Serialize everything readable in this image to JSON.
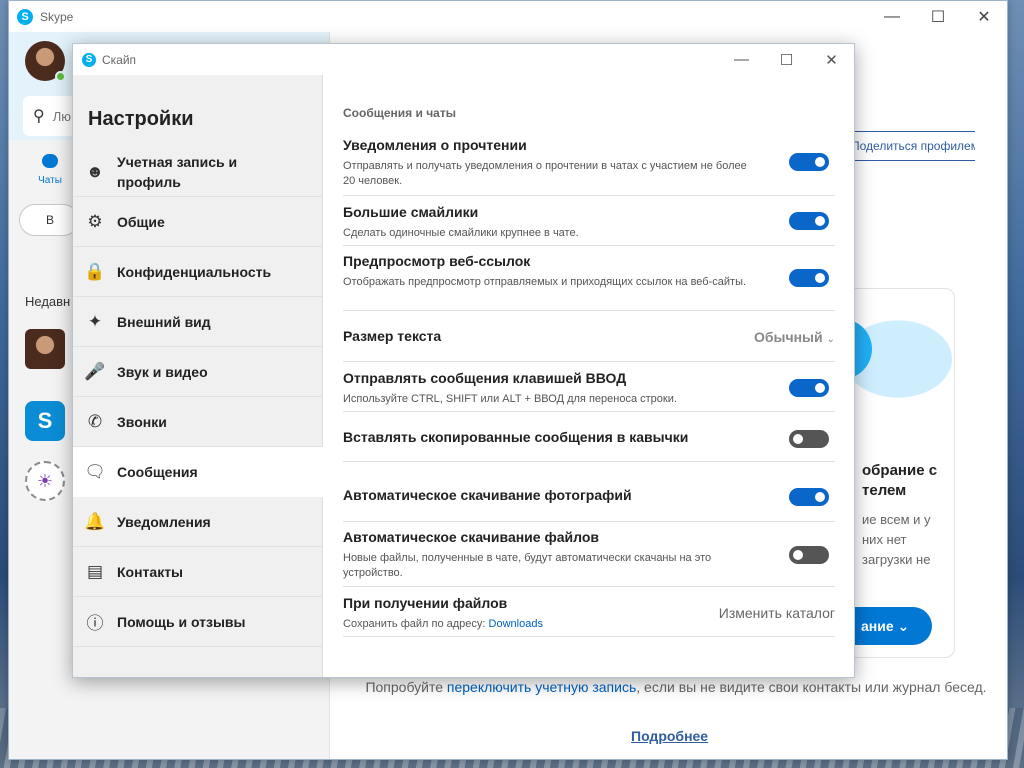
{
  "main_window": {
    "title": "Skype",
    "search_placeholder": "Лю… инт…",
    "chats_label": "Чаты",
    "meet_label": "В",
    "recent_label": "Недавн",
    "share_profile_label": "Поделиться профилем",
    "promo_title": "обрание с телем",
    "promo_text": "ие всем и у них нет загрузки не",
    "promo_button": "ание",
    "switch_text_before": "Попробуйте ",
    "switch_link": "переключить учетную запись",
    "switch_text_after": ", если вы не видите свои контакты или журнал бесед.",
    "more_link": "Подробнее"
  },
  "dialog": {
    "title": "Скайп",
    "heading": "Настройки"
  },
  "nav": [
    {
      "label": "Учетная запись и профиль",
      "icon": "user-icon"
    },
    {
      "label": "Общие",
      "icon": "gear-icon"
    },
    {
      "label": "Конфиденциальность",
      "icon": "lock-icon"
    },
    {
      "label": "Внешний вид",
      "icon": "magic-wand-icon"
    },
    {
      "label": "Звук и видео",
      "icon": "microphone-icon"
    },
    {
      "label": "Звонки",
      "icon": "phone-icon"
    },
    {
      "label": "Сообщения",
      "icon": "chat-icon"
    },
    {
      "label": "Уведомления",
      "icon": "bell-icon"
    },
    {
      "label": "Контакты",
      "icon": "contacts-icon"
    },
    {
      "label": "Помощь и отзывы",
      "icon": "info-icon"
    }
  ],
  "active_nav": "Сообщения",
  "section_title": "Сообщения и чаты",
  "settings": {
    "read_receipts": {
      "title": "Уведомления о прочтении",
      "desc": "Отправлять и получать уведомления о прочтении в чатах с участием не более 20 человек.",
      "on": true
    },
    "large_emoticons": {
      "title": "Большие смайлики",
      "desc": "Сделать одиночные смайлики крупнее в чате.",
      "on": true
    },
    "link_preview": {
      "title": "Предпросмотр веб-ссылок",
      "desc": "Отображать предпросмотр отправляемых и приходящих ссылок на веб-сайты.",
      "on": true
    },
    "text_size": {
      "title": "Размер текста",
      "value": "Обычный"
    },
    "enter_send": {
      "title": "Отправлять сообщения клавишей ВВОД",
      "desc": "Используйте CTRL, SHIFT или ALT + ВВОД для переноса строки.",
      "on": true
    },
    "paste_quotes": {
      "title": "Вставлять скопированные сообщения в кавычки",
      "on": false
    },
    "auto_photos": {
      "title": "Автоматическое скачивание фотографий",
      "on": true
    },
    "auto_files": {
      "title": "Автоматическое скачивание файлов",
      "desc": "Новые файлы, полученные в чате, будут автоматически скачаны на это устройство.",
      "on": false
    },
    "receiving_files": {
      "title": "При получении файлов",
      "desc_prefix": "Сохранить файл по адресу: ",
      "folder": "Downloads",
      "change_label": "Изменить каталог"
    }
  },
  "colors": {
    "accent": "#0a66c8",
    "toggle_off": "#555555",
    "skype_blue": "#00aff0"
  }
}
